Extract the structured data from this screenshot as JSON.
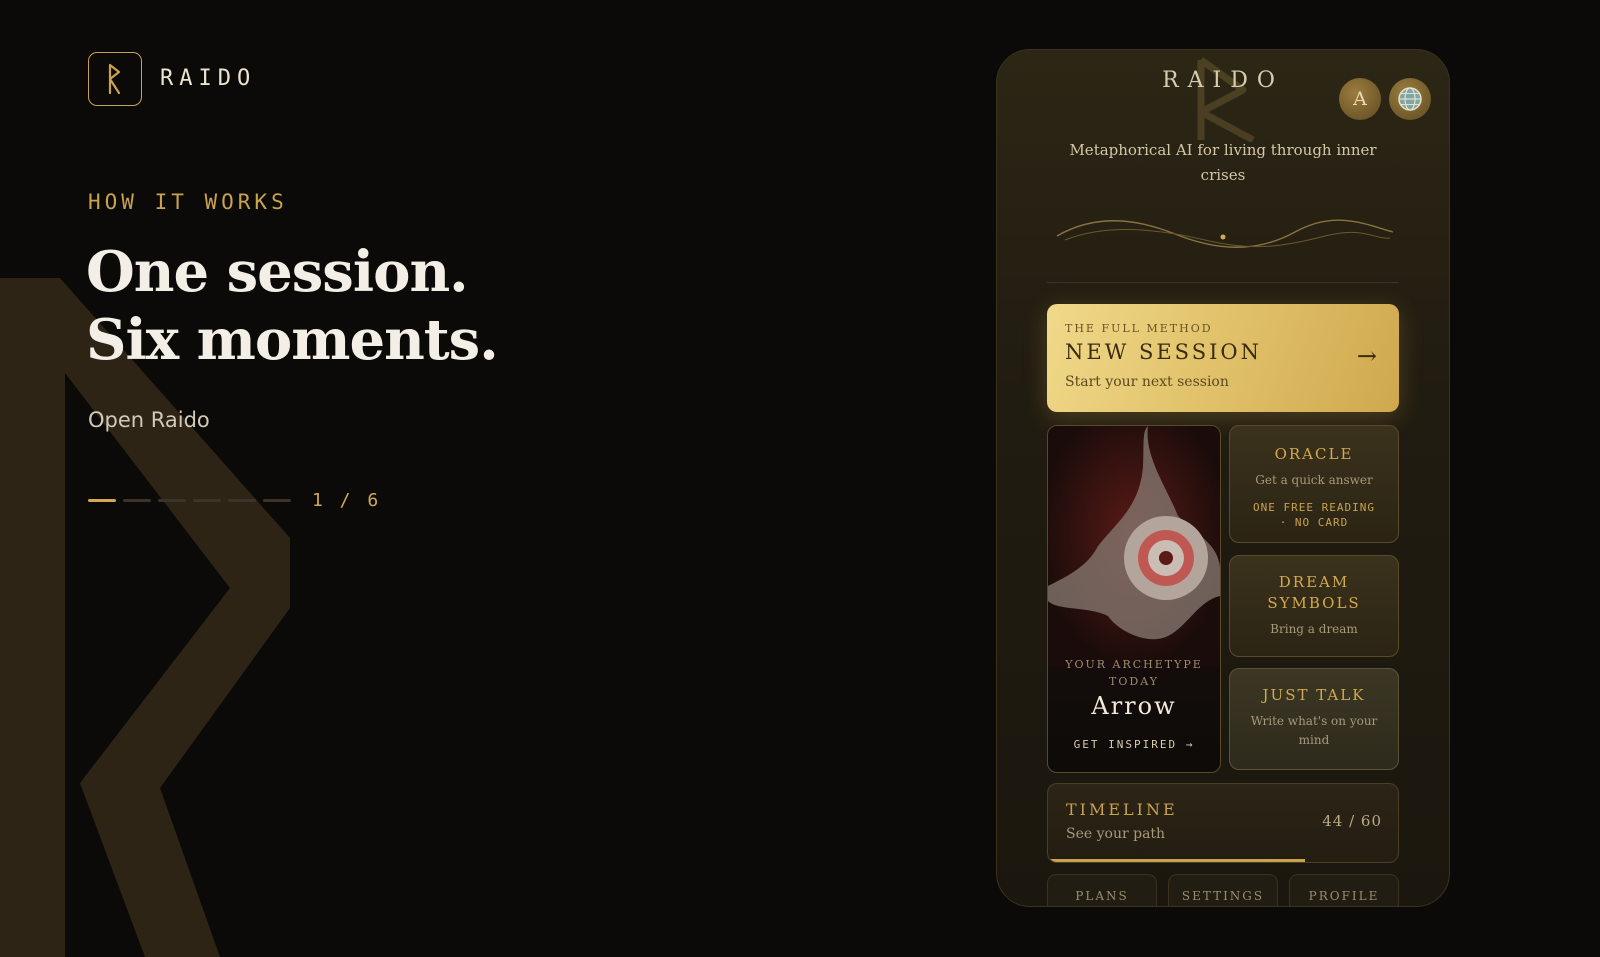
{
  "brand": {
    "name": "RAIDO"
  },
  "hero": {
    "eyebrow": "HOW IT WORKS",
    "headline_line1": "One session.",
    "headline_line2": "Six moments.",
    "step_text": "Open Raido",
    "progress": {
      "current": 1,
      "total": 6,
      "label": "1 / 6"
    }
  },
  "phone": {
    "brand": "RAIDO",
    "avatar_initial": "A",
    "tagline": "Metaphorical AI for living through inner crises",
    "new_session": {
      "eyebrow": "THE FULL METHOD",
      "title": "NEW SESSION",
      "subtitle": "Start your next session",
      "arrow": "→"
    },
    "archetype": {
      "label": "YOUR ARCHETYPE TODAY",
      "name": "Arrow",
      "cta": "GET INSPIRED →"
    },
    "oracle": {
      "title": "ORACLE",
      "subtitle": "Get a quick answer",
      "note": "ONE FREE READING · NO CARD"
    },
    "dream": {
      "title": "DREAM SYMBOLS",
      "subtitle": "Bring a dream"
    },
    "talk": {
      "title": "JUST TALK",
      "subtitle": "Write what's on your mind"
    },
    "timeline": {
      "title": "TIMELINE",
      "subtitle": "See your path",
      "count": "44 / 60",
      "progress": 0.733
    },
    "bottom_tabs": [
      "PLANS",
      "SETTINGS",
      "PROFILE"
    ]
  },
  "colors": {
    "background": "#0b0a08",
    "gold": "#c9a24e",
    "gold_light": "#e2c36c",
    "text": "#f4efe6"
  },
  "icons": [
    "raido-rune-icon",
    "globe-icon",
    "arrow-right-icon"
  ]
}
